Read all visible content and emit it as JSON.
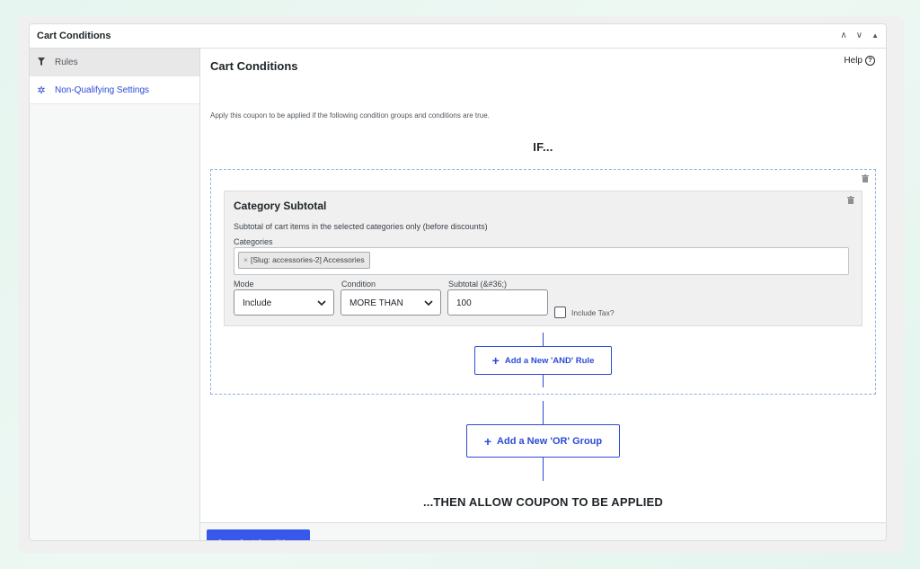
{
  "panel": {
    "title": "Cart Conditions",
    "controls": [
      "∧",
      "∨",
      "▲"
    ]
  },
  "sidebar": {
    "items": [
      {
        "label": "Rules",
        "icon": "filter-icon"
      },
      {
        "label": "Non-Qualifying Settings",
        "icon": "gear-icon"
      }
    ]
  },
  "main": {
    "title": "Cart Conditions",
    "help_label": "Help",
    "description": "Apply this coupon to be applied if the following condition groups and conditions are true.",
    "if_text": "IF...",
    "then_text": "...THEN ALLOW COUPON TO BE APPLIED"
  },
  "rule": {
    "title": "Category Subtotal",
    "description": "Subtotal of cart items in the selected categories only (before discounts)",
    "categories_label": "Categories",
    "category_tag": "[Slug: accessories-2] Accessories",
    "tag_remove": "×",
    "mode_label": "Mode",
    "mode_value": "Include",
    "condition_label": "Condition",
    "condition_value": "MORE THAN",
    "subtotal_label": "Subtotal (&#36;)",
    "subtotal_value": "100",
    "include_tax_label": "Include Tax?"
  },
  "buttons": {
    "add_and": "Add a New 'AND' Rule",
    "add_or": "Add a New 'OR' Group",
    "save": "Save Cart Conditions"
  },
  "colors": {
    "accent": "#3858e9",
    "link": "#2c4ad6",
    "group_border": "#8ab4e0"
  }
}
